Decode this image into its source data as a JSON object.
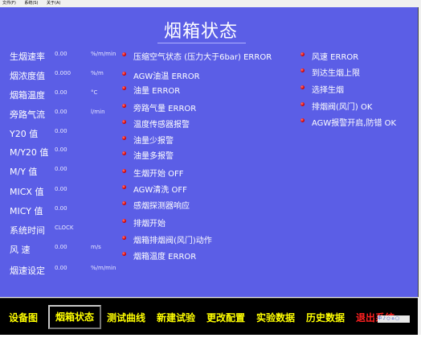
{
  "menu": [
    "文件(F)",
    "系统(S)",
    "关于(A)"
  ],
  "title": "烟箱状态",
  "params": [
    {
      "label": "生烟速率",
      "value": "0.00",
      "unit": "%/m/min"
    },
    {
      "label": "烟浓度值",
      "value": "0.000",
      "unit": "%/m"
    },
    {
      "label": "烟箱温度",
      "value": "0.00",
      "unit": "°C"
    },
    {
      "label": "旁路气流",
      "value": "0.00",
      "unit": "l/min"
    },
    {
      "label": "Y20  值",
      "value": "0.00",
      "unit": ""
    },
    {
      "label": "M/Y20 值",
      "value": "0.00",
      "unit": ""
    },
    {
      "label": "M/Y  值",
      "value": "0.00",
      "unit": ""
    },
    {
      "label": "MICX 值",
      "value": "0.00",
      "unit": ""
    },
    {
      "label": "MICY 值",
      "value": "0.00",
      "unit": ""
    },
    {
      "label": "系统时间",
      "value": "CLOCK",
      "unit": ""
    },
    {
      "label": "风    速",
      "value": "0.00",
      "unit": "m/s"
    },
    {
      "label": "烟速设定",
      "value": "0.00",
      "unit": "%/m/min"
    }
  ],
  "status_middle": [
    "压缩空气状态 (压力大于6bar) ERROR",
    "AGW油温 ERROR",
    "油量 ERROR",
    "旁路气量 ERROR",
    "温度传感器报警",
    "油量少报警",
    "油量多报警",
    "生烟开始 OFF",
    "AGW清洗 OFF",
    "感烟探测器响应",
    "排烟开始",
    "烟箱排烟阀(风门)动作",
    "烟箱温度  ERROR"
  ],
  "status_right": [
    "风速  ERROR",
    "到达生烟上限",
    "选择生烟",
    "排烟阀(风门) OK",
    "AGW报警开启,防错 OK"
  ],
  "nav": [
    "设备图",
    "烟箱状态",
    "测试曲线",
    "新建试验",
    "更改配置",
    "实验数据",
    "历史数据",
    "退出系统"
  ],
  "tray": "中 ♪ ○ ⌂ ▢",
  "colors": {
    "background": "#5b5ee6",
    "nav_text": "#ffff00",
    "exit_text": "#ff2020",
    "led": "#d40000"
  }
}
